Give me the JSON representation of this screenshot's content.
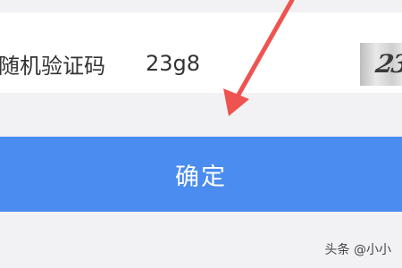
{
  "captcha": {
    "label": "随机验证码",
    "input_value": "23g8",
    "image_text": "23"
  },
  "confirm": {
    "label": "确定",
    "color": "#4a8cef"
  },
  "annotation": {
    "icon": "red-arrow-icon",
    "color": "#ef5350"
  },
  "watermark": {
    "text": "头条 @小小"
  }
}
